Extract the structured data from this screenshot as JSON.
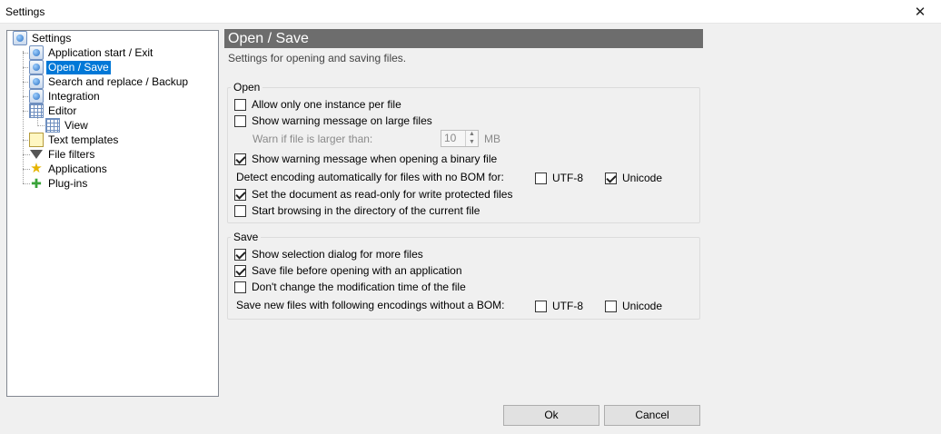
{
  "window": {
    "title": "Settings"
  },
  "tree": {
    "root": "Settings",
    "items": [
      {
        "label": "Application start / Exit"
      },
      {
        "label": "Open / Save"
      },
      {
        "label": "Search and replace / Backup"
      },
      {
        "label": "Integration"
      },
      {
        "label": "Editor"
      },
      {
        "label": "View"
      },
      {
        "label": "Text templates"
      },
      {
        "label": "File filters"
      },
      {
        "label": "Applications"
      },
      {
        "label": "Plug-ins"
      }
    ]
  },
  "page": {
    "title": "Open / Save",
    "subtitle": "Settings for opening and saving files."
  },
  "open_group": {
    "legend": "Open",
    "one_instance": {
      "label": "Allow only one instance per file",
      "checked": false
    },
    "warn_large": {
      "label": "Show warning message on large files",
      "checked": false
    },
    "warn_threshold_label": "Warn if file is larger than:",
    "warn_threshold_value": "10",
    "warn_threshold_unit": "MB",
    "warn_binary": {
      "label": "Show warning message when opening a binary file",
      "checked": true
    },
    "detect_encoding_label": "Detect encoding automatically for files with no BOM for:",
    "detect_utf8": {
      "label": "UTF-8",
      "checked": false
    },
    "detect_unicode": {
      "label": "Unicode",
      "checked": true
    },
    "readonly": {
      "label": "Set the document as read-only for write protected files",
      "checked": true
    },
    "start_browsing": {
      "label": "Start browsing in the directory of the current file",
      "checked": false
    }
  },
  "save_group": {
    "legend": "Save",
    "selection_dialog": {
      "label": "Show selection dialog for more files",
      "checked": true
    },
    "save_before": {
      "label": "Save file before opening with an application",
      "checked": true
    },
    "keep_mtime": {
      "label": "Don't change the modification time of the file",
      "checked": false
    },
    "encodings_label": "Save new files with following encodings without a BOM:",
    "save_utf8": {
      "label": "UTF-8",
      "checked": false
    },
    "save_unicode": {
      "label": "Unicode",
      "checked": false
    }
  },
  "buttons": {
    "ok": "Ok",
    "cancel": "Cancel"
  }
}
